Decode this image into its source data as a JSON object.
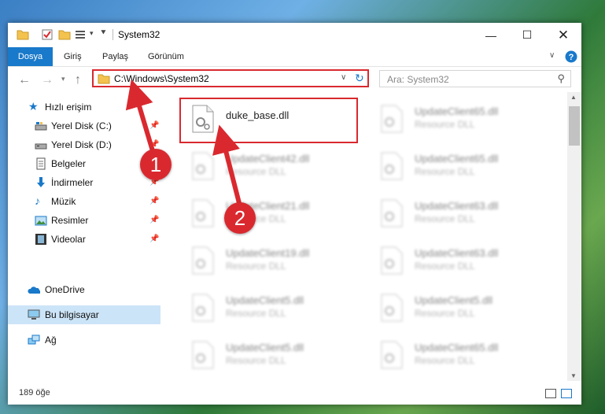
{
  "window": {
    "title": "System32",
    "quick_access_icons": [
      "folder-icon",
      "properties-check-icon",
      "new-folder-icon",
      "customize-icon",
      "dropdown-arrow-icon"
    ]
  },
  "ribbon": {
    "tabs": [
      {
        "label": "Dosya",
        "active": true
      },
      {
        "label": "Giriş"
      },
      {
        "label": "Paylaş"
      },
      {
        "label": "Görünüm"
      }
    ]
  },
  "address": {
    "path": "C:\\Windows\\System32",
    "search_placeholder": "Ara: System32"
  },
  "sidebar": {
    "items": [
      {
        "label": "Hızlı erişim",
        "icon": "star-icon"
      },
      {
        "label": "Yerel Disk (C:)",
        "icon": "drive-c-icon",
        "pinned": true
      },
      {
        "label": "Yerel Disk (D:)",
        "icon": "drive-d-icon",
        "pinned": true
      },
      {
        "label": "Belgeler",
        "icon": "documents-icon",
        "pinned": true
      },
      {
        "label": "İndirmeler",
        "icon": "downloads-icon",
        "pinned": true
      },
      {
        "label": "Müzik",
        "icon": "music-icon",
        "pinned": true
      },
      {
        "label": "Resimler",
        "icon": "pictures-icon",
        "pinned": true
      },
      {
        "label": "Videolar",
        "icon": "videos-icon",
        "pinned": true
      },
      {
        "label": "OneDrive",
        "icon": "onedrive-icon"
      },
      {
        "label": "Bu bilgisayar",
        "icon": "computer-icon",
        "selected": true
      },
      {
        "label": "Ağ",
        "icon": "network-icon"
      }
    ]
  },
  "files": {
    "highlighted": {
      "name": "duke_base.dll"
    },
    "left_column": [
      {
        "name": "UpdateClient42.dll",
        "type": "Resource DLL"
      },
      {
        "name": "UpdateClient21.dll",
        "type": "Resource DLL"
      },
      {
        "name": "UpdateClient19.dll",
        "type": "Resource DLL"
      },
      {
        "name": "UpdateClient5.dll",
        "type": "Resource DLL"
      },
      {
        "name": "UpdateClient5.dll",
        "type": "Resource DLL"
      }
    ],
    "right_column": [
      {
        "name": "UpdateClient65.dll",
        "type": "Resource DLL"
      },
      {
        "name": "UpdateClient65.dll",
        "type": "Resource DLL"
      },
      {
        "name": "UpdateClient63.dll",
        "type": "Resource DLL"
      },
      {
        "name": "UpdateClient63.dll",
        "type": "Resource DLL"
      },
      {
        "name": "UpdateClient5.dll",
        "type": "Resource DLL"
      },
      {
        "name": "UpdateClient65.dll",
        "type": "Resource DLL"
      }
    ]
  },
  "status": {
    "item_count": "189 öğe"
  },
  "annotations": {
    "step1": "1",
    "step2": "2"
  },
  "colors": {
    "accent": "#1979ca",
    "highlight": "#d9292f",
    "selected": "#cce4f7"
  }
}
